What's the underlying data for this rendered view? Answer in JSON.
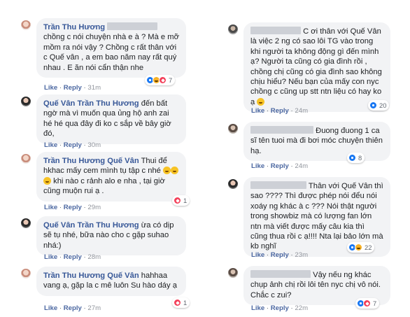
{
  "colors": {
    "link": "#385898",
    "bubble": "#f2f3f5",
    "meta": "#90949c",
    "like": "#1877f2",
    "love": "#f33e58",
    "haha": "#f7b125"
  },
  "left": [
    {
      "author": "Trần Thu Hương",
      "text": "chồng c nói chuyện nhà e à ? Mà e mỡ mồm ra nói vậy ? Chồng c rất thân với c Quế vân , a em bao năm nay rất quý nhau . E ăn nói cẩn thận nhe",
      "like": "Like",
      "reply": "Reply",
      "time": "31m",
      "reactions": [
        "like-icon",
        "haha-icon",
        "love-icon"
      ],
      "reaction_count": "7"
    },
    {
      "author": "Quế Vân",
      "mention": "Trần Thu Hương",
      "text": "đến bất ngờ mà vì muốn qua ủng hộ anh zai hé hé qua đây đi ko c sắp về bây giờ đó,",
      "like": "Like",
      "reply": "Reply",
      "time": "30m"
    },
    {
      "author": "Trần Thu Hương",
      "mention": "Quế Vân",
      "text_1": "Thui để hkhac mấy cem mình tụ tập c nhé",
      "text_2": "khi nào c rảnh alo e nha , tại giờ cũng muộn rui ạ .",
      "like": "Like",
      "reply": "Reply",
      "time": "29m",
      "reactions": [
        "love-icon"
      ],
      "reaction_count": "1"
    },
    {
      "author": "Quế Vân",
      "mention": "Trần Thu Hương",
      "text": "ừa có dịp sẽ tụ nhé, bữa nào cho c gặp suhao nhá:)",
      "like": "Like",
      "reply": "Reply",
      "time": "28m"
    },
    {
      "author": "Trần Thu Hương",
      "mention": "Quế Vân",
      "text": "hahhaa vang ạ, gặp la c mê luôn Su hào dáy ạ",
      "like": "Like",
      "reply": "Reply",
      "time": "27m",
      "reactions": [
        "love-icon"
      ],
      "reaction_count": "1"
    }
  ],
  "right": [
    {
      "text": "C ơi thân với Quế Vân là việc 2 ng có sao lôi TG vào trong khi người ta không động gì đến mình ạ? Người ta cũng có gia đình rồi , chồng chị cũng có gia đình sao không chịu hiểu? Nếu bạn của mấy con nyc chồng c cũng up stt ntn liệu có hay ko ạ",
      "like": "Like",
      "reply": "Reply",
      "time": "24m",
      "reactions": [
        "like-icon"
      ],
      "reaction_count": "20"
    },
    {
      "text": "Đuong đuong 1 ca sĩ tên tuoi mà đi bơi móc chuyện thiên hạ.",
      "like": "Like",
      "reply": "Reply",
      "time": "24m",
      "reactions": [
        "like-icon"
      ],
      "reaction_count": "8"
    },
    {
      "text": "Thân với Quế Vân thì sao ???? Thì được phép nói đểu nói xoáy ng khác à c ??? Nói thật người trong showbiz mà có lượng fan lớn ntn mà viết được mấy câu kia thì cũng thua rồi c ạ!!!! Nta lại bảo lớn mà kb nghĩ",
      "like": "Like",
      "reply": "Reply",
      "time": "23m",
      "reactions": [
        "like-icon",
        "haha-icon"
      ],
      "reaction_count": "22"
    },
    {
      "text": "Vậy nếu ng khác chụp ảnh chị rồi lôi tên nyc chị vô nói. Chắc c zui?",
      "like": "Like",
      "reply": "Reply",
      "time": "22m",
      "reactions": [
        "like-icon",
        "love-icon"
      ],
      "reaction_count": "7"
    }
  ]
}
